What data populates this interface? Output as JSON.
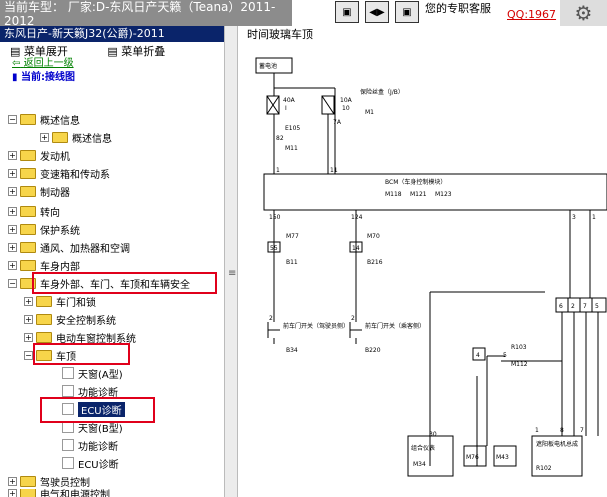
{
  "banner": {
    "title": "当前车型： 厂家:D-东风日产天籁（Teana）2011-2012",
    "nav_first": "▣",
    "nav_mid": "◀▶",
    "nav_last": "▣",
    "service": "您的专职客服",
    "qq": "QQ:1967"
  },
  "left": {
    "header": "东风日产-新天籁J32(公爵)-2011",
    "expand_all": "菜单展开",
    "collapse_all": "菜单折叠",
    "back": "返回上一级",
    "current": "当前:接线图",
    "tree": [
      {
        "label": "概述信息"
      },
      {
        "label": "概述信息"
      },
      {
        "label": "发动机"
      },
      {
        "label": "变速箱和传动系"
      },
      {
        "label": "制动器"
      },
      {
        "label": "转向"
      },
      {
        "label": "保护系统"
      },
      {
        "label": "通风、加热器和空调"
      },
      {
        "label": "车身内部"
      },
      {
        "label": "车身外部、车门、车顶和车辆安全"
      },
      {
        "label": "车门和锁"
      },
      {
        "label": "安全控制系统"
      },
      {
        "label": "电动车窗控制系统"
      },
      {
        "label": "车顶"
      },
      {
        "label": "天窗(A型)"
      },
      {
        "label": "功能诊断"
      },
      {
        "label": "ECU诊断"
      },
      {
        "label": "天窗(B型)"
      },
      {
        "label": "功能诊断"
      },
      {
        "label": "ECU诊断"
      },
      {
        "label": "驾驶员控制"
      },
      {
        "label": "电气和电源控制"
      }
    ]
  },
  "diagram": {
    "title": "时间玻璃车顶",
    "battery": "蓄电池",
    "fuse_40a": "40A",
    "fuse_40a_num": "I",
    "fuse_10a": "10A",
    "fuse_10a_num": "10",
    "fuse_box": "保险丝盒（J/B）",
    "m1": "M1",
    "e105": "E105",
    "m11": "M11",
    "w82": "82",
    "w7a": "7A",
    "bcm": "BCM（车身控制模块）",
    "m118": "M118",
    "m121": "M121",
    "m123": "M123",
    "p1a": "1",
    "p1b": "11",
    "p150": "150",
    "p124": "124",
    "p3a": "3",
    "p3b": "1",
    "m77": "M77",
    "b11": "B11",
    "w55": "55",
    "m70": "M70",
    "b216": "B216",
    "w14": "14",
    "door_sw_front": "前车门开关（驾驶员侧）",
    "door_sw_pass": "前车门开关（乘客侧）",
    "b34": "B34",
    "b220": "B220",
    "p2a": "2",
    "p2b": "2",
    "c6": "6",
    "c2": "2",
    "c7": "7",
    "c5": "5",
    "r103": "R103",
    "m112": "M112",
    "c4": "4",
    "c5b": "5",
    "combo": "组合仪表",
    "m34": "M34",
    "p30": "30",
    "m76": "M76",
    "m43": "M43",
    "sunshade": "遮阳板电机总成",
    "r102": "R102",
    "c1": "1",
    "c8": "8",
    "c7b": "7"
  }
}
